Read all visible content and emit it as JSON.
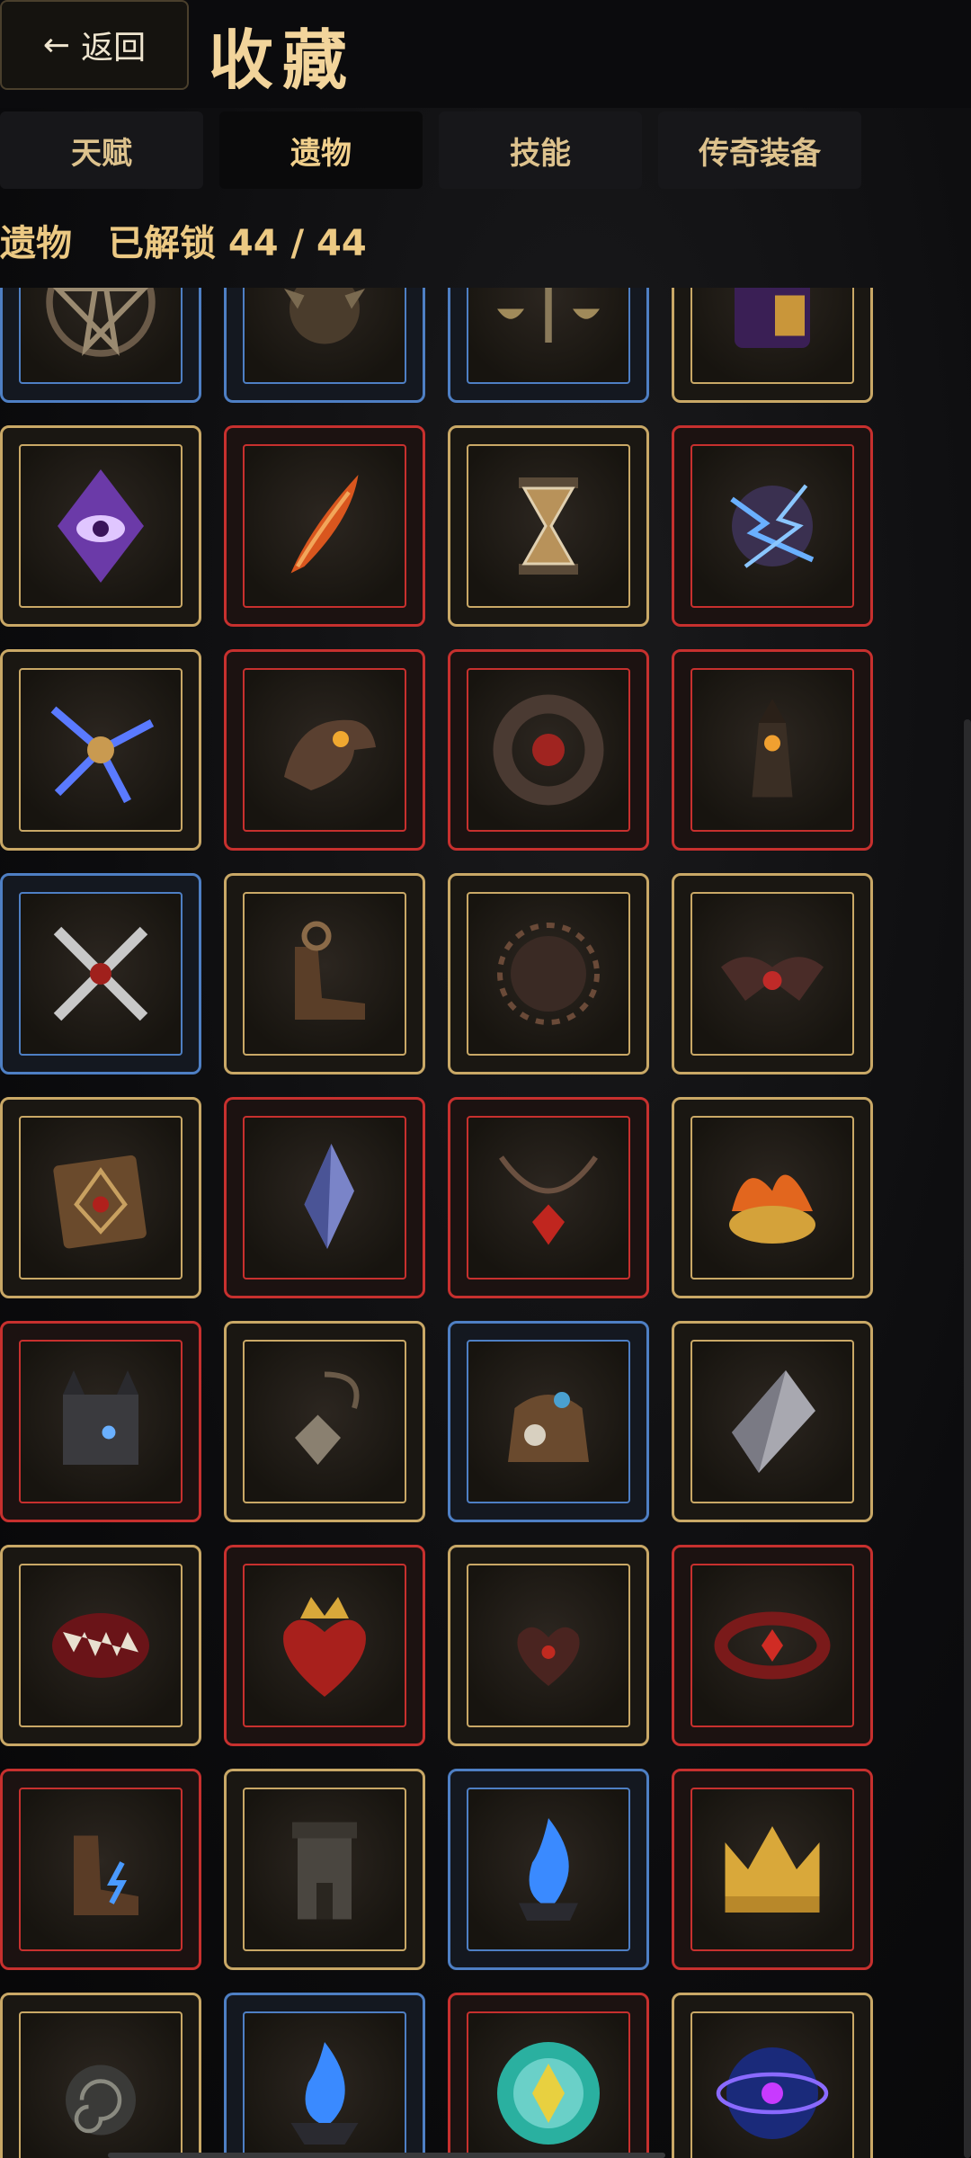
{
  "header": {
    "back_arrow": "←",
    "back_label": "返回",
    "title": "收藏"
  },
  "tabs": [
    {
      "label": "天赋",
      "active": false
    },
    {
      "label": "遗物",
      "active": true
    },
    {
      "label": "技能",
      "active": false
    },
    {
      "label": "传奇装备",
      "active": false
    }
  ],
  "status": {
    "category": "遗物",
    "unlocked_label": "已解锁",
    "unlocked": 44,
    "total": 44,
    "unlocked_text": "已解锁 44 / 44"
  },
  "colors": {
    "common": "#c9a866",
    "rare": "#4e7fc4",
    "legendary": "#c7302e"
  },
  "relics": [
    {
      "icon": "pentagram-icon",
      "rarity": "rare"
    },
    {
      "icon": "spiked-orb-icon",
      "rarity": "rare"
    },
    {
      "icon": "scales-icon",
      "rarity": "rare"
    },
    {
      "icon": "purple-tome-icon",
      "rarity": "common"
    },
    {
      "icon": "purple-eye-crystal-icon",
      "rarity": "common"
    },
    {
      "icon": "fire-feather-icon",
      "rarity": "legendary"
    },
    {
      "icon": "chained-hourglass-icon",
      "rarity": "common"
    },
    {
      "icon": "lightning-orb-icon",
      "rarity": "legendary"
    },
    {
      "icon": "lightning-shuriken-icon",
      "rarity": "common"
    },
    {
      "icon": "eagle-head-icon",
      "rarity": "legendary"
    },
    {
      "icon": "ember-ring-icon",
      "rarity": "legendary"
    },
    {
      "icon": "lantern-tower-icon",
      "rarity": "legendary"
    },
    {
      "icon": "crossed-swords-icon",
      "rarity": "rare"
    },
    {
      "icon": "winged-boot-icon",
      "rarity": "common"
    },
    {
      "icon": "spiked-shield-icon",
      "rarity": "common"
    },
    {
      "icon": "bat-amulet-icon",
      "rarity": "common"
    },
    {
      "icon": "rune-tablet-icon",
      "rarity": "common"
    },
    {
      "icon": "blue-crystal-icon",
      "rarity": "legendary"
    },
    {
      "icon": "ruby-necklace-icon",
      "rarity": "legendary"
    },
    {
      "icon": "burning-gold-icon",
      "rarity": "common"
    },
    {
      "icon": "dark-fortress-icon",
      "rarity": "legendary"
    },
    {
      "icon": "spiked-pendant-icon",
      "rarity": "common"
    },
    {
      "icon": "treasure-sack-icon",
      "rarity": "rare"
    },
    {
      "icon": "silver-shard-icon",
      "rarity": "common"
    },
    {
      "icon": "fanged-mouth-icon",
      "rarity": "common"
    },
    {
      "icon": "crowned-heart-icon",
      "rarity": "legendary"
    },
    {
      "icon": "thorned-heart-icon",
      "rarity": "common"
    },
    {
      "icon": "blood-ring-icon",
      "rarity": "legendary"
    },
    {
      "icon": "lightning-boot-icon",
      "rarity": "legendary"
    },
    {
      "icon": "stone-tower-icon",
      "rarity": "common"
    },
    {
      "icon": "blue-flame-icon",
      "rarity": "rare"
    },
    {
      "icon": "golden-crown-icon",
      "rarity": "legendary"
    },
    {
      "icon": "spiral-amulet-icon",
      "rarity": "common"
    },
    {
      "icon": "blue-flame-brazier-icon",
      "rarity": "rare"
    },
    {
      "icon": "golden-gem-medallion-icon",
      "rarity": "legendary"
    },
    {
      "icon": "arcane-sphere-icon",
      "rarity": "common"
    }
  ]
}
